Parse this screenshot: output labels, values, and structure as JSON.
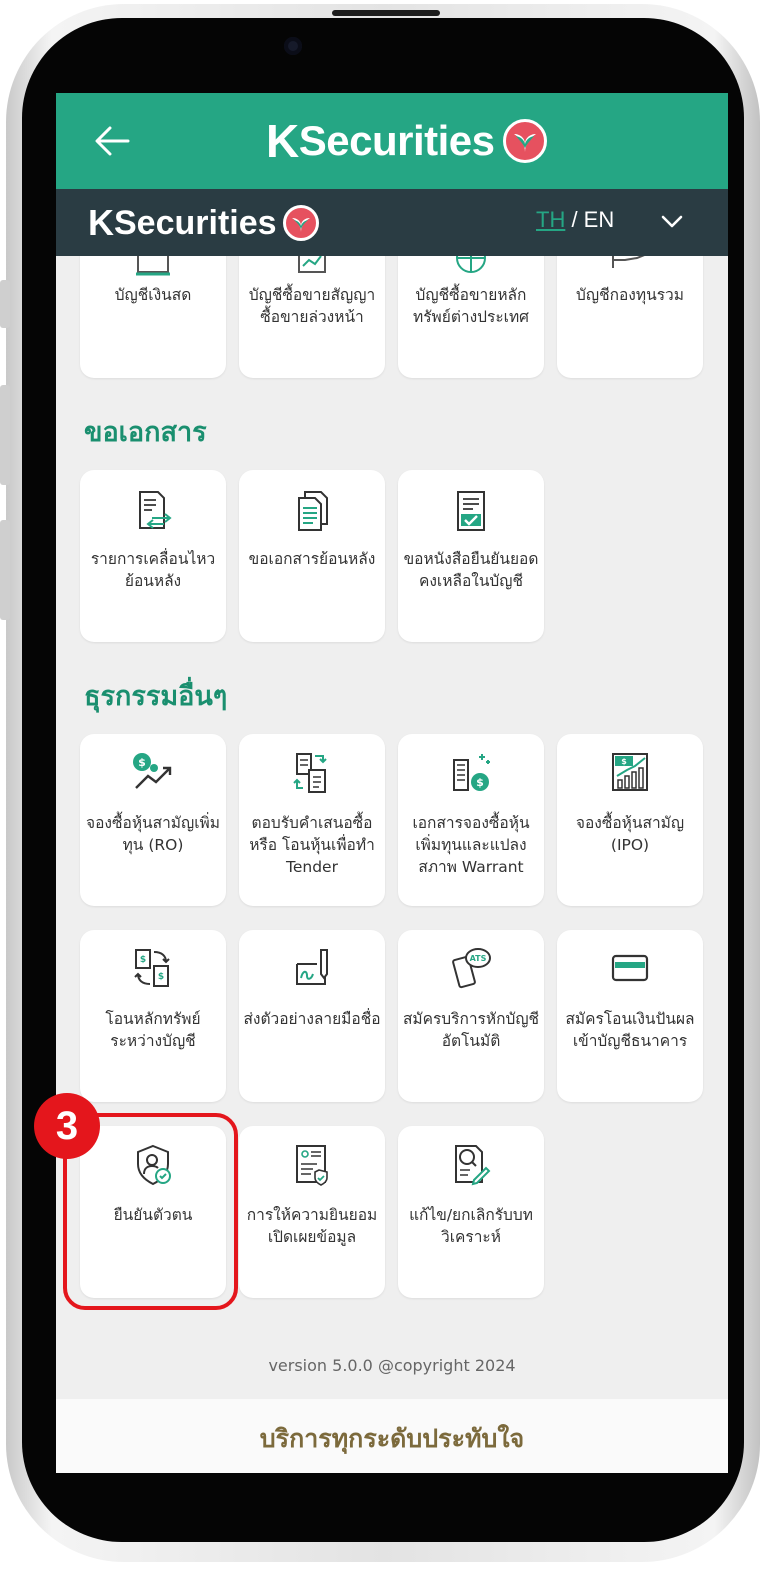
{
  "header": {
    "brand": "KSecurities",
    "brand_k": "K",
    "brand_rest": "Securities"
  },
  "subheader": {
    "brand_k": "K",
    "brand_rest": "Securities",
    "lang_th": "TH",
    "lang_sep": " / EN"
  },
  "accounts": {
    "items": [
      {
        "label": "บัญชีเงินสด",
        "icon": "cash-account-icon"
      },
      {
        "label": "บัญชีซื้อขายสัญญาซื้อขายล่วงหน้า",
        "icon": "derivatives-account-icon"
      },
      {
        "label": "บัญชีซื้อขายหลักทรัพย์ต่างประเทศ",
        "icon": "globe-icon"
      },
      {
        "label": "บัญชีกองทุนรวม",
        "icon": "fund-hand-icon"
      }
    ]
  },
  "documents": {
    "title": "ขอเอกสาร",
    "items": [
      {
        "label": "รายการเคลื่อนไหวย้อนหลัง",
        "icon": "document-transfer-icon"
      },
      {
        "label": "ขอเอกสารย้อนหลัง",
        "icon": "documents-stack-icon"
      },
      {
        "label": "ขอหนังสือยืนยันยอดคงเหลือในบัญชี",
        "icon": "document-check-icon"
      }
    ]
  },
  "other": {
    "title": "ธุรกรรมอื่นๆ",
    "items": [
      {
        "label": "จองซื้อหุ้นสามัญเพิ่มทุน (RO)",
        "icon": "coin-growth-icon"
      },
      {
        "label": "ตอบรับคำเสนอซื้อ หรือ โอนหุ้นเพื่อทำ Tender",
        "icon": "document-exchange-icon"
      },
      {
        "label": "เอกสารจองซื้อหุ้นเพิ่มทุนและแปลงสภาพ Warrant",
        "icon": "building-money-icon"
      },
      {
        "label": "จองซื้อหุ้นสามัญ (IPO)",
        "icon": "ipo-chart-icon"
      },
      {
        "label": "โอนหลักทรัพย์ระหว่างบัญชี",
        "icon": "securities-transfer-icon"
      },
      {
        "label": "ส่งตัวอย่างลายมือชื่อ",
        "icon": "signature-pen-icon"
      },
      {
        "label": "สมัครบริการหักบัญชีอัตโนมัติ",
        "icon": "ats-phone-icon"
      },
      {
        "label": "สมัครโอนเงินปันผลเข้าบัญชีธนาคาร",
        "icon": "bank-card-icon"
      },
      {
        "label": "ยืนยันตัวตน",
        "icon": "identity-shield-icon"
      },
      {
        "label": "การให้ความยินยอมเปิดเผยข้อมูล",
        "icon": "consent-document-icon"
      },
      {
        "label": "แก้ไข/ยกเลิกรับบทวิเคราะห์",
        "icon": "research-edit-icon"
      }
    ]
  },
  "footer": {
    "version": "version 5.0.0 @copyright 2024",
    "tagline": "บริการทุกระดับประทับใจ"
  },
  "annotation": {
    "step": "3"
  },
  "colors": {
    "primary": "#25a684",
    "dark_bar": "#2a3c43",
    "section_title": "#1a8f6f",
    "highlight": "#e4161c",
    "logo": "#e6515f"
  }
}
